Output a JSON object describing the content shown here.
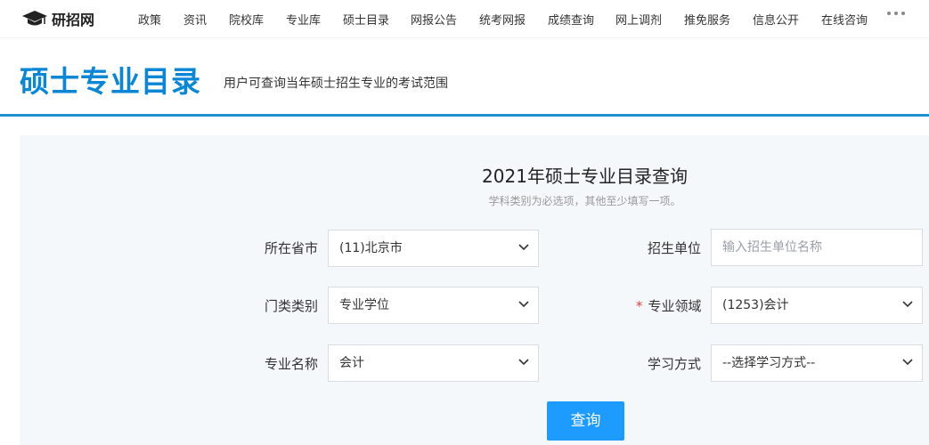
{
  "brand": {
    "name": "研招网"
  },
  "nav": {
    "items": [
      "政策",
      "资讯",
      "院校库",
      "专业库",
      "硕士目录",
      "网报公告",
      "统考网报",
      "成绩查询",
      "网上调剂",
      "推免服务",
      "信息公开",
      "在线咨询"
    ]
  },
  "header": {
    "title": "硕士专业目录",
    "subtitle": "用户可查询当年硕士招生专业的考试范围"
  },
  "form": {
    "title": "2021年硕士专业目录查询",
    "hint": "学科类别为必选项，其他至少填写一项。",
    "fields": {
      "province": {
        "label": "所在省市",
        "value": "(11)北京市"
      },
      "institution": {
        "label": "招生单位",
        "placeholder": "输入招生单位名称"
      },
      "category": {
        "label": "门类类别",
        "value": "专业学位"
      },
      "field_area": {
        "label": "专业领域",
        "required_mark": "*",
        "value": "(1253)会计"
      },
      "major": {
        "label": "专业名称",
        "value": "会计"
      },
      "study_mode": {
        "label": "学习方式",
        "value": "--选择学习方式--"
      }
    },
    "submit_label": "查询"
  },
  "icons": {
    "logo": "graduation-cap-icon",
    "more": "more-dots-icon",
    "dropdown": "chevron-down-icon"
  },
  "colors": {
    "title_blue": "#0a86d6",
    "rule_blue": "#1f8fcf",
    "button_blue": "#1e9bff",
    "required_red": "#e0433a"
  }
}
